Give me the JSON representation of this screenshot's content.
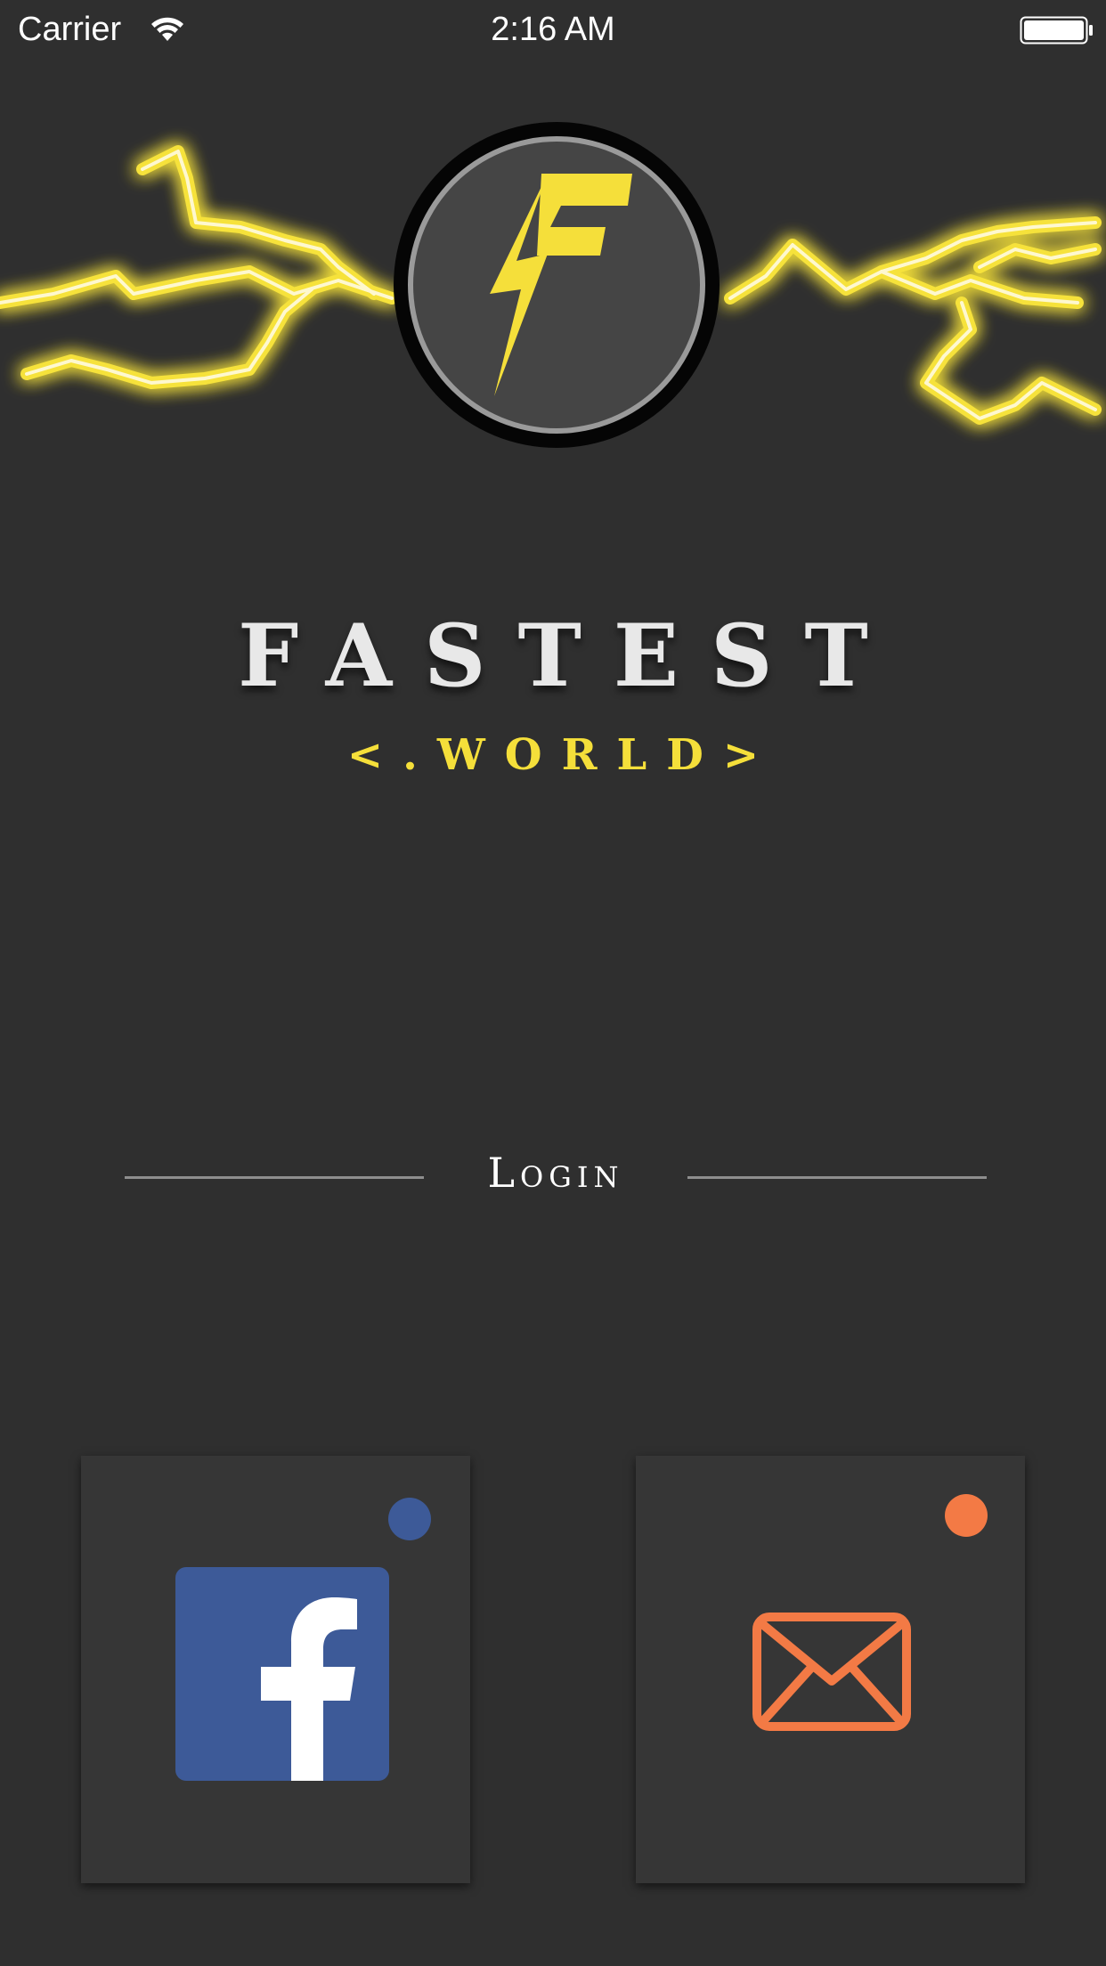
{
  "status_bar": {
    "carrier": "Carrier",
    "time": "2:16 AM",
    "wifi_icon": "wifi-icon",
    "battery_icon": "battery-icon"
  },
  "brand": {
    "logo_icon": "lightning-f-logo",
    "title": "FASTEST",
    "subtitle": "<.WORLD>"
  },
  "login": {
    "label": "Login"
  },
  "login_options": [
    {
      "icon": "facebook-icon",
      "dot_color": "#3d5a98"
    },
    {
      "icon": "mail-icon",
      "dot_color": "#f37a45"
    }
  ],
  "colors": {
    "background": "#2f2f2f",
    "accent_yellow": "#f5df3a",
    "facebook_blue": "#3d5a98",
    "email_orange": "#f37a45",
    "tile": "#363636"
  }
}
